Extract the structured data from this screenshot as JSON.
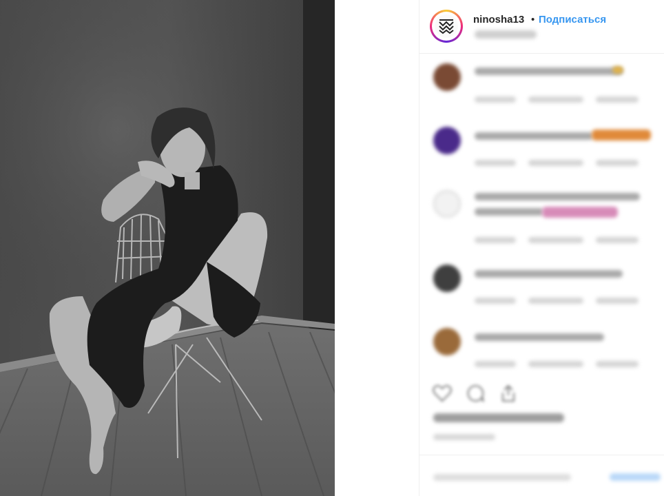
{
  "post": {
    "username": "ninosha13",
    "separator": "•",
    "follow_label": "Подписаться"
  },
  "icons": {
    "avatar": "brand-logo-avatar",
    "like": "heart-icon",
    "comment": "speech-bubble-icon",
    "share": "share-icon"
  },
  "colors": {
    "follow": "#3897f0",
    "text": "#262626",
    "divider": "#efefef"
  }
}
